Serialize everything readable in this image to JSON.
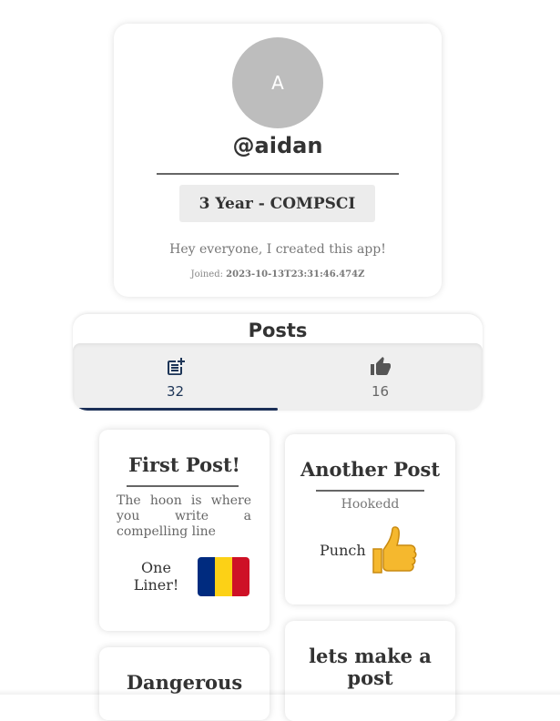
{
  "profile": {
    "avatar_initial": "A",
    "username": "@aidan",
    "program": "3 Year - COMPSCI",
    "bio": "Hey everyone, I created this app!",
    "joined_label": "Joined:",
    "joined_value": "2023-10-13T23:31:46.474Z"
  },
  "posts_section": {
    "title": "Posts",
    "tabs": [
      {
        "icon": "post-add-icon",
        "count": "32",
        "active": true
      },
      {
        "icon": "thumb-up-icon",
        "count": "16",
        "active": false
      }
    ]
  },
  "posts": [
    {
      "title": "First Post!",
      "body": "The hoon is where you write a compelling line",
      "extra": "One Liner!",
      "emoji": "romania-flag"
    },
    {
      "title": "Another Post",
      "body": "Hookedd",
      "extra": "Punch",
      "emoji": "thumbs-up"
    },
    {
      "title": "Dangerous"
    },
    {
      "title": "lets make a post"
    }
  ],
  "colors": {
    "accent": "#1b2f57",
    "avatar_bg": "#bdbdbd",
    "chip_bg": "#ececec",
    "tab_bg": "#efefef"
  }
}
